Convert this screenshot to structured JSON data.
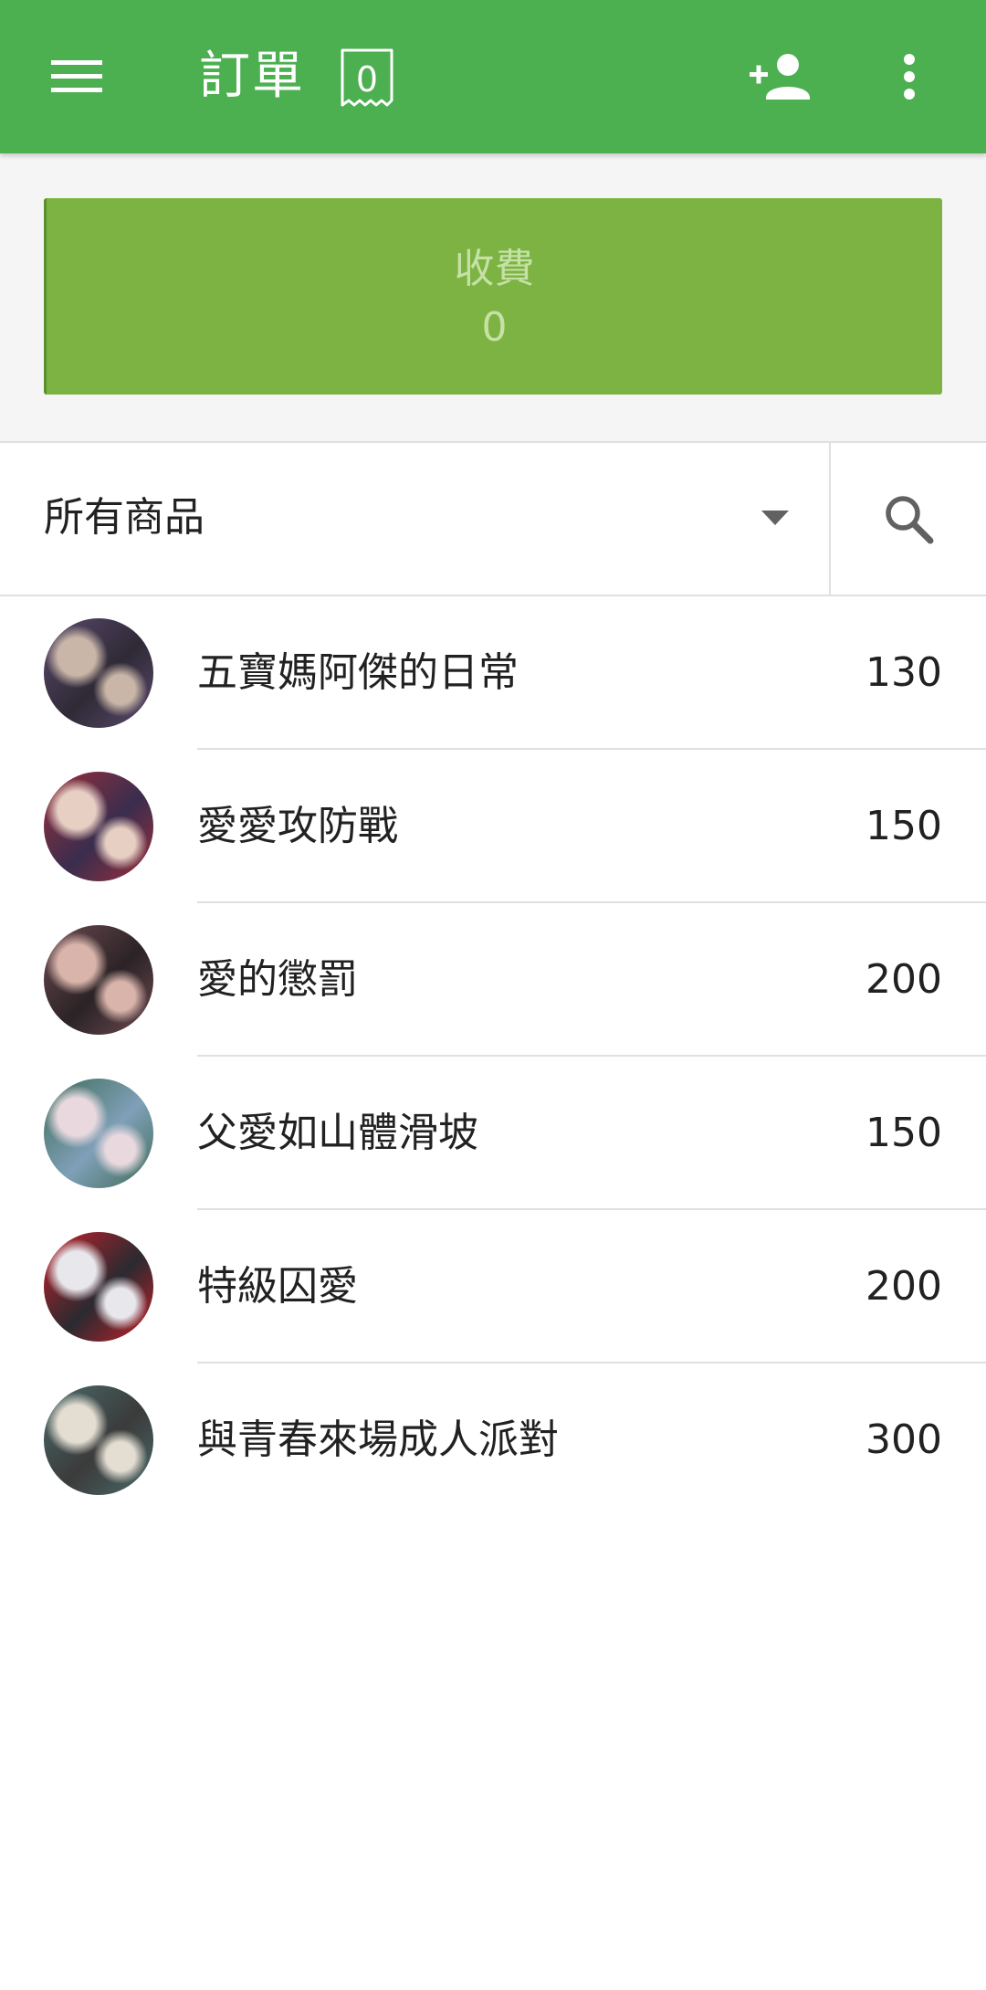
{
  "app_bar": {
    "title": "訂單",
    "ticket_count": "0",
    "colors": {
      "background": "#4caf50",
      "foreground": "#ffffff"
    },
    "icons": [
      "menu-icon",
      "ticket-icon",
      "add-user-icon",
      "more-vert-icon"
    ]
  },
  "charge": {
    "label": "收費",
    "amount": "0",
    "colors": {
      "background": "#7cb342",
      "text": "#c5e1a5"
    }
  },
  "filter": {
    "category": "所有商品",
    "icons": [
      "dropdown-arrow-icon",
      "search-icon"
    ]
  },
  "products": [
    {
      "name": "五寶媽阿傑的日常",
      "price": "130",
      "thumb_colors": [
        "#5b4a6e",
        "#c9b6a8",
        "#2f2a36"
      ]
    },
    {
      "name": "愛愛攻防戰",
      "price": "150",
      "thumb_colors": [
        "#9c2f3a",
        "#e7cfc4",
        "#3a2d4e"
      ]
    },
    {
      "name": "愛的懲罰",
      "price": "200",
      "thumb_colors": [
        "#6e4b52",
        "#d8b4aa",
        "#2b2326"
      ]
    },
    {
      "name": "父愛如山體滑坡",
      "price": "150",
      "thumb_colors": [
        "#3f6b57",
        "#e9d9df",
        "#7fa0b8"
      ]
    },
    {
      "name": "特級囚愛",
      "price": "200",
      "thumb_colors": [
        "#c8202a",
        "#e8e8ec",
        "#2a2a30"
      ]
    },
    {
      "name": "與青春來場成人派對",
      "price": "300",
      "thumb_colors": [
        "#4a6b6a",
        "#e3ddd2",
        "#3b3b3b"
      ]
    }
  ]
}
